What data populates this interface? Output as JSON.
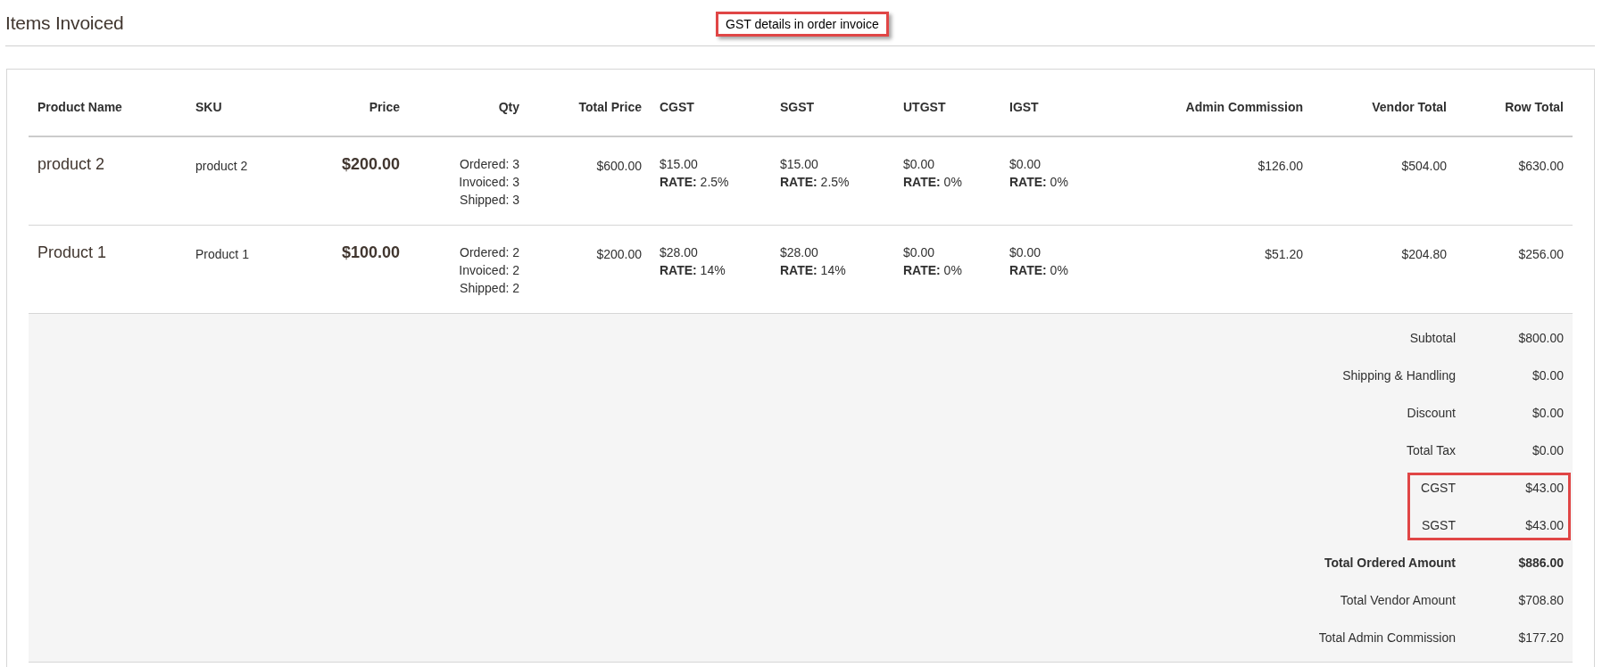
{
  "page": {
    "title": "Items Invoiced"
  },
  "annotation": {
    "text": "GST details in order invoice"
  },
  "table": {
    "columns": [
      "Product Name",
      "SKU",
      "Price",
      "Qty",
      "Total Price",
      "CGST",
      "SGST",
      "UTGST",
      "IGST",
      "Admin Commission",
      "Vendor Total",
      "Row Total"
    ],
    "rows": [
      {
        "cells": [
          {
            "kind": "name",
            "text": "product 2"
          },
          {
            "kind": "sku",
            "text": "product 2"
          },
          {
            "kind": "price",
            "text": "$200.00"
          },
          {
            "kind": "qty",
            "lines": [
              "Ordered: 3",
              "Invoiced: 3",
              "Shipped: 3"
            ]
          },
          {
            "kind": "amount",
            "text": "$600.00"
          },
          {
            "kind": "tax",
            "amount": "$15.00",
            "rate": "**RATE:** 2.5%"
          },
          {
            "kind": "tax",
            "amount": "$15.00",
            "rate": "**RATE:** 2.5%"
          },
          {
            "kind": "tax",
            "amount": "$0.00",
            "rate": "**RATE:** 0%"
          },
          {
            "kind": "tax",
            "amount": "$0.00",
            "rate": "**RATE:** 0%"
          },
          {
            "kind": "amount",
            "text": "$126.00"
          },
          {
            "kind": "amount",
            "text": "$504.00"
          },
          {
            "kind": "amount",
            "text": "$630.00"
          }
        ]
      },
      {
        "cells": [
          {
            "kind": "name",
            "text": "Product 1"
          },
          {
            "kind": "sku",
            "text": "Product 1"
          },
          {
            "kind": "price",
            "text": "$100.00"
          },
          {
            "kind": "qty",
            "lines": [
              "Ordered: 2",
              "Invoiced: 2",
              "Shipped: 2"
            ]
          },
          {
            "kind": "amount",
            "text": "$200.00"
          },
          {
            "kind": "tax",
            "amount": "$28.00",
            "rate": "**RATE:** 14%"
          },
          {
            "kind": "tax",
            "amount": "$28.00",
            "rate": "**RATE:** 14%"
          },
          {
            "kind": "tax",
            "amount": "$0.00",
            "rate": "**RATE:** 0%"
          },
          {
            "kind": "tax",
            "amount": "$0.00",
            "rate": "**RATE:** 0%"
          },
          {
            "kind": "amount",
            "text": "$51.20"
          },
          {
            "kind": "amount",
            "text": "$204.80"
          },
          {
            "kind": "amount",
            "text": "$256.00"
          }
        ]
      }
    ]
  },
  "totals": [
    {
      "label": "Subtotal",
      "value": "$800.00",
      "bold": false,
      "highlighted": false
    },
    {
      "label": "Shipping & Handling",
      "value": "$0.00",
      "bold": false,
      "highlighted": false
    },
    {
      "label": "Discount",
      "value": "$0.00",
      "bold": false,
      "highlighted": false
    },
    {
      "label": "Total Tax",
      "value": "$0.00",
      "bold": false,
      "highlighted": false
    },
    {
      "label": "CGST",
      "value": "$43.00",
      "bold": false,
      "highlighted": true
    },
    {
      "label": "SGST",
      "value": "$43.00",
      "bold": false,
      "highlighted": true
    },
    {
      "label": "Total Ordered Amount",
      "value": "$886.00",
      "bold": true,
      "highlighted": false
    },
    {
      "label": "Total Vendor Amount",
      "value": "$708.80",
      "bold": false,
      "highlighted": false
    },
    {
      "label": "Total Admin Commission",
      "value": "$177.20",
      "bold": false,
      "highlighted": false
    }
  ]
}
